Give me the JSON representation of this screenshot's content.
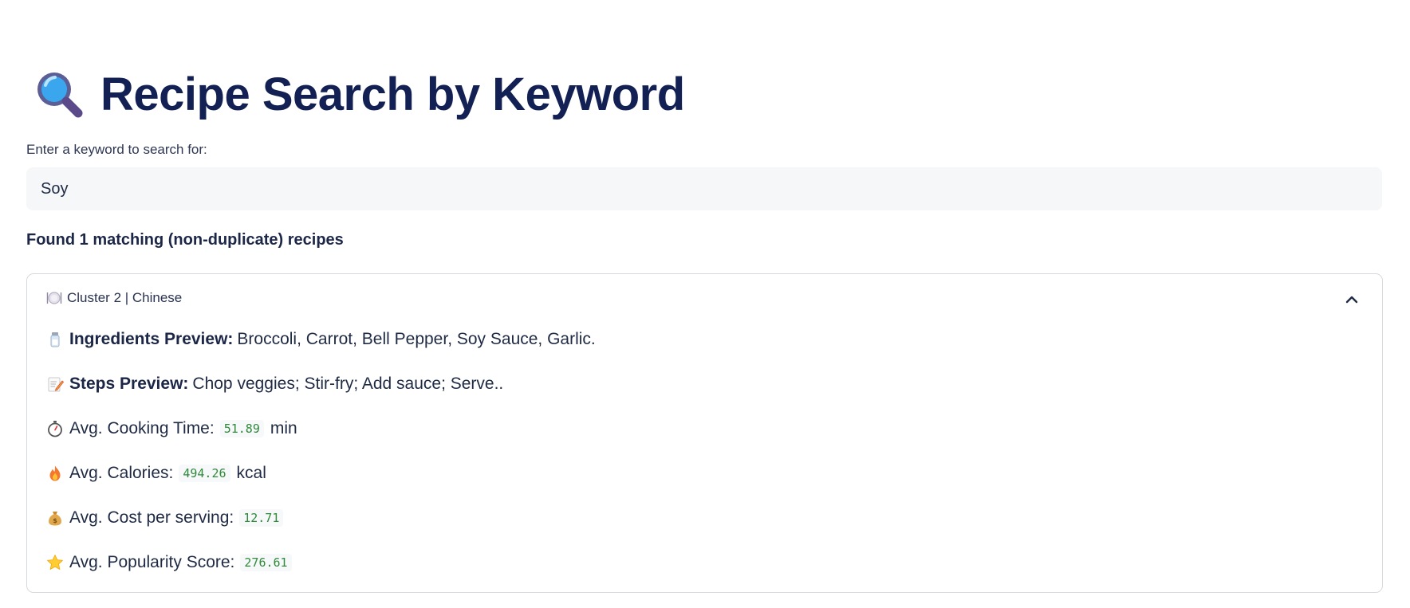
{
  "header": {
    "title": "Recipe Search by Keyword",
    "icon": "magnifier-icon"
  },
  "search": {
    "label": "Enter a keyword to search for:",
    "value": "Soy"
  },
  "results": {
    "count_text": "Found 1 matching (non-duplicate) recipes"
  },
  "expander": {
    "header_label": "Cluster 2 | Chinese",
    "expanded": true,
    "rows": {
      "ingredients": {
        "label": "Ingredients Preview:",
        "value": "Broccoli, Carrot, Bell Pepper, Soy Sauce, Garlic."
      },
      "steps": {
        "label": "Steps Preview:",
        "value": "Chop veggies; Stir-fry; Add sauce; Serve.."
      },
      "cooking_time": {
        "label": "Avg. Cooking Time:",
        "value": "51.89",
        "unit": "min"
      },
      "calories": {
        "label": "Avg. Calories:",
        "value": "494.26",
        "unit": "kcal"
      },
      "cost": {
        "label": "Avg. Cost per serving:",
        "value": "12.71"
      },
      "popularity": {
        "label": "Avg. Popularity Score:",
        "value": "276.61"
      }
    }
  },
  "colors": {
    "title": "#132053",
    "code_text": "#2f8a3a",
    "input_bg": "#f6f7f9",
    "border": "#d6d9de"
  }
}
